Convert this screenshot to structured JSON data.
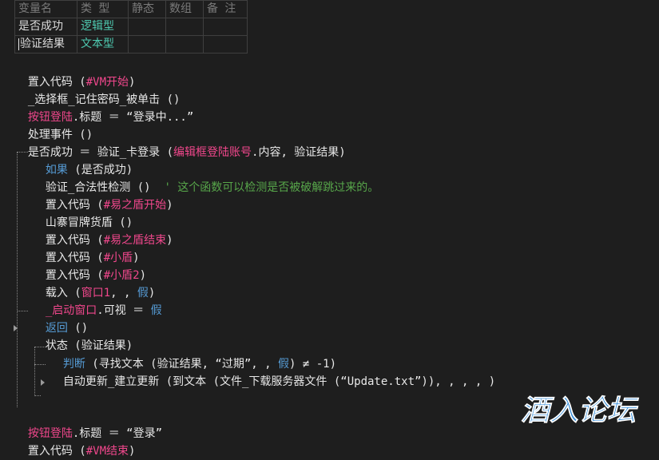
{
  "var_table": {
    "headers": [
      "变量名",
      "类 型",
      "静态",
      "数组",
      "备 注"
    ],
    "rows": [
      {
        "name": "是否成功",
        "type": "逻辑型",
        "static": "",
        "array": "",
        "note": ""
      },
      {
        "name": "验证结果",
        "type": "文本型",
        "static": "",
        "array": "",
        "note": ""
      }
    ]
  },
  "code": {
    "l1a": "置入代码 (",
    "l1b": "#VM开始",
    "l1c": ")",
    "l2": "_选择框_记住密码_被单击 ()",
    "l3a": "按钮登陆",
    "l3b": ".标题 ＝ “登录中...”",
    "l4": "处理事件 ()",
    "l5a": "是否成功 ＝ 验证_卡登录 (",
    "l5b": "编辑框登陆账号",
    "l5c": ".内容, 验证结果)",
    "l6a": "如果",
    "l6b": " (是否成功)",
    "l7a": "验证_合法性检测 ()  ",
    "l7b": "' 这个函数可以检测是否被破解跳过来的。",
    "l8a": "置入代码 (",
    "l8b": "#易之盾开始",
    "l8c": ")",
    "l9": "山寨冒牌货盾 ()",
    "l10a": "置入代码 (",
    "l10b": "#易之盾结束",
    "l10c": ")",
    "l11a": "置入代码 (",
    "l11b": "#小盾",
    "l11c": ")",
    "l12a": "置入代码 (",
    "l12b": "#小盾2",
    "l12c": ")",
    "l13a": "载入 (",
    "l13b": "窗口1",
    "l13c": ", , ",
    "l13d": "假",
    "l13e": ")",
    "l14a": "_启动窗口",
    "l14b": ".可视 ＝ ",
    "l14c": "假",
    "l15a": "返回",
    "l15b": " ()",
    "l16": "状态 (验证结果)",
    "l17a": "判断",
    "l17b": " (寻找文本 (验证结果, “过期”, , ",
    "l17c": "假",
    "l17d": ") ≠ -1)",
    "l18": "自动更新_建立更新 (到文本 (文件_下载服务器文件 (“Update.txt”)), , , , )",
    "l19a": "按钮登陆",
    "l19b": ".标题 ＝ “登录”",
    "l20a": "置入代码 (",
    "l20b": "#VM结束",
    "l20c": ")"
  },
  "watermark": {
    "text": "酒入论坛",
    "color": "#3a8fd9"
  }
}
